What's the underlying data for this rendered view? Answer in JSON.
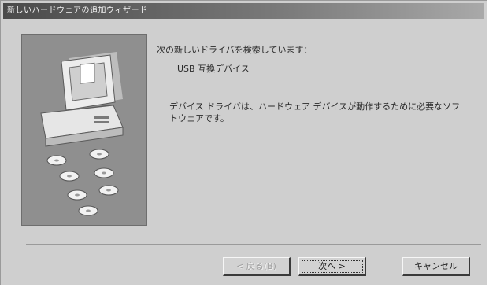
{
  "window": {
    "title": "新しいハードウェアの追加ウィザード"
  },
  "content": {
    "intro": "次の新しいドライバを検索しています：",
    "device_name": "USB 互換デバイス",
    "description": "デバイス ドライバは、ハードウェア デバイスが動作するために必要なソフトウェアです。"
  },
  "buttons": {
    "back": "< 戻る(B)",
    "next": "次へ >",
    "cancel": "キャンセル"
  },
  "icons": {
    "illustration": "computer-with-disks-illustration"
  }
}
